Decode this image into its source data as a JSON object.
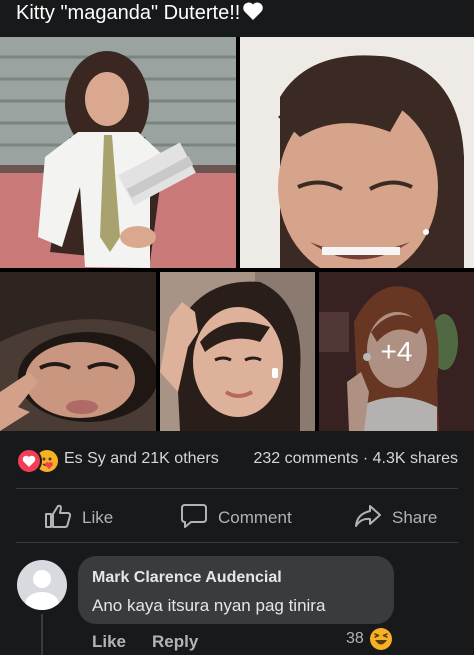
{
  "post": {
    "title": "Kitty \"maganda\" Duterte!!",
    "title_icon": "white-heart-icon"
  },
  "gallery": {
    "more_count": "+4",
    "photos": [
      "photo-1",
      "photo-2",
      "photo-3",
      "photo-4",
      "photo-5"
    ]
  },
  "stats": {
    "reactions": [
      "love-reaction-icon",
      "care-reaction-icon"
    ],
    "likes_text": "Es Sy and 21K others",
    "comments_text": "232 comments",
    "separator": "·",
    "shares_text": "4.3K shares"
  },
  "actions": {
    "like_label": "Like",
    "comment_label": "Comment",
    "share_label": "Share"
  },
  "comment": {
    "author": "Mark Clarence Audencial",
    "text": "Ano kaya itsura nyan pag tinira",
    "like_label": "Like",
    "reply_label": "Reply",
    "reaction_count": "38",
    "reaction_icon": "laughing-emoji-icon"
  },
  "colors": {
    "background": "#18191a",
    "bubble": "#3a3b3c",
    "muted_text": "#b0b3b8",
    "love": "#f33e58",
    "care": "#f7b125"
  }
}
